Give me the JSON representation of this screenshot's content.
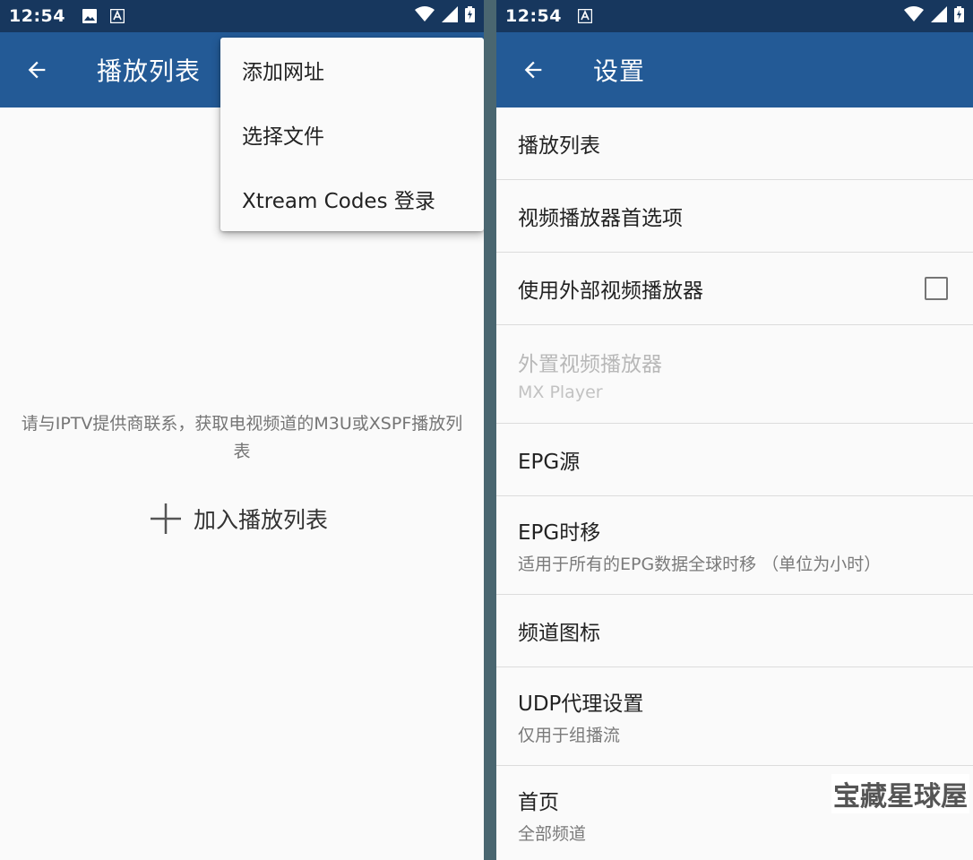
{
  "left": {
    "status": {
      "time": "12:54"
    },
    "appbar": {
      "title": "播放列表"
    },
    "empty_message": "请与IPTV提供商联系，获取电视频道的M3U或XSPF播放列表",
    "add_playlist_label": "加入播放列表",
    "menu": {
      "items": [
        {
          "label": "添加网址"
        },
        {
          "label": "选择文件"
        },
        {
          "label": "Xtream Codes 登录"
        }
      ]
    }
  },
  "right": {
    "status": {
      "time": "12:54"
    },
    "appbar": {
      "title": "设置"
    },
    "settings": [
      {
        "title": "播放列表"
      },
      {
        "title": "视频播放器首选项"
      },
      {
        "title": "使用外部视频播放器",
        "checked": false
      },
      {
        "title": "外置视频播放器",
        "subtitle": "MX Player",
        "disabled": true
      },
      {
        "title": "EPG源"
      },
      {
        "title": "EPG时移",
        "subtitle": "适用于所有的EPG数据全球时移 （单位为小时）"
      },
      {
        "title": "频道图标"
      },
      {
        "title": "UDP代理设置",
        "subtitle": "仅用于组播流"
      },
      {
        "title": "首页",
        "subtitle": "全部频道"
      }
    ]
  },
  "watermark": "宝藏星球屋",
  "colors": {
    "status_bar": "#17375e",
    "app_bar": "#235a96",
    "background": "#fafafa",
    "divider": "#4a6670"
  }
}
